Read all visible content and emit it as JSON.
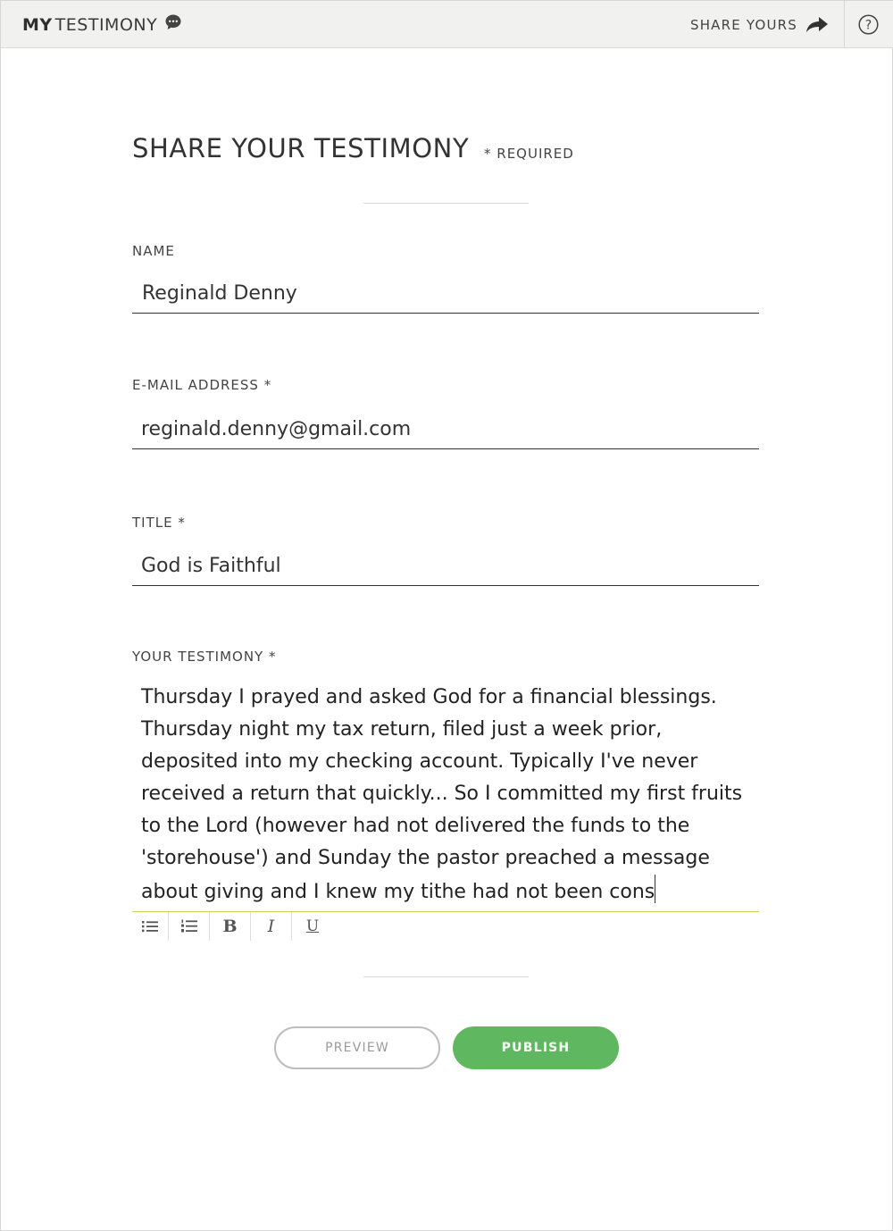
{
  "header": {
    "logo_my": "MY",
    "logo_testimony": "TESTIMONY",
    "share_yours": "SHARE YOURS",
    "help_glyph": "?"
  },
  "form": {
    "heading": "SHARE YOUR TESTIMONY",
    "required_note": "* REQUIRED",
    "name": {
      "label": "NAME",
      "value": "Reginald Denny"
    },
    "email": {
      "label": "E-MAIL ADDRESS *",
      "value": "reginald.denny@gmail.com"
    },
    "title": {
      "label": "TITLE *",
      "value": "God is Faithful"
    },
    "testimony": {
      "label": "YOUR TESTIMONY *",
      "value": "Thursday I prayed and asked God for a financial blessings. Thursday night my tax return, filed just a week prior, deposited into my checking account. Typically I've never received a return that quickly... So I committed my first fruits to the Lord (however had not delivered the funds to the 'storehouse') and Sunday the pastor preached a message about giving and I knew my tithe had not been cons"
    },
    "toolbar": {
      "bold": "B",
      "italic": "I",
      "underline": "U"
    }
  },
  "actions": {
    "preview": "PREVIEW",
    "publish": "PUBLISH"
  },
  "colors": {
    "publish_green": "#5fb85f",
    "active_underline": "#cfcf52"
  }
}
